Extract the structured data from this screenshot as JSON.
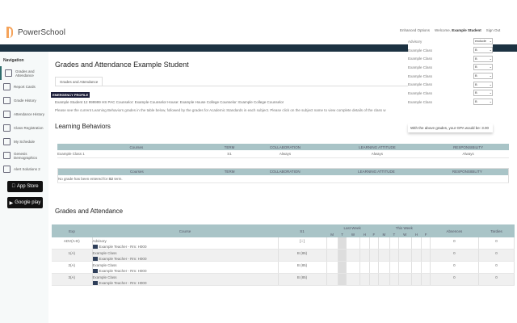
{
  "header": {
    "logo": "PowerSchool",
    "links": [
      "Enhanced Options",
      "Welcome,",
      "Example Student",
      "Sign Out"
    ]
  },
  "nav": {
    "title": "Navigation",
    "items": [
      "Grades and Attendance",
      "Report Cards",
      "Grade History",
      "Attendance History",
      "Class Registration",
      "My Schedule",
      "Genesis Demographics",
      "Alert Solutions 2"
    ],
    "stores": [
      "App Store",
      "Google play"
    ]
  },
  "main": {
    "title": "Grades and Attendance Example Student",
    "tab": "Grades and Attendance",
    "badge": "EMERGENCY PROFILE",
    "info": "Example Student   12   999999          HS      PAC Counselor: Example Counselor    House: Example House    College Counselor: Example College Counselor",
    "note": "Please see the current Learning Behaviors grades in the table below, followed by the grades for Academic Standards in each subject. Please click on the subject name to view complete details of the class w"
  },
  "lb": {
    "title": "Learning Behaviors",
    "headers": [
      "Courses",
      "TERM",
      "COLLABORATION",
      "LEARNING ATTITUDE",
      "RESPONSIBILITY"
    ],
    "row": [
      "Example Class 1",
      "S1",
      "Always",
      "Always",
      "Always"
    ],
    "empty_prefix": "No grade has been entered for ",
    "empty_term": "S2",
    "empty_suffix": " term."
  },
  "popup": {
    "rows": [
      [
        "Advisory",
        "exclude"
      ],
      [
        "Example Class",
        "B"
      ],
      [
        "Example Class",
        "B"
      ],
      [
        "Example Class",
        "B"
      ],
      [
        "Example Class",
        "B"
      ],
      [
        "Example Class",
        "B"
      ],
      [
        "Example Class",
        "B"
      ],
      [
        "Example Class",
        "B"
      ]
    ],
    "gpa": "With the above grades, your GPA would be: 3.00"
  },
  "ga": {
    "title": "Grades and Attendance",
    "headers": {
      "exp": "Exp",
      "course": "Course",
      "s1": "S1",
      "last": "Last Week",
      "this": "This Week",
      "abs": "Absences",
      "tar": "Tardies",
      "days": [
        "M",
        "T",
        "W",
        "H",
        "F",
        "M",
        "T",
        "W",
        "H",
        "F"
      ]
    },
    "rows": [
      {
        "exp": "ADV(A-E)",
        "course": "Advisory",
        "teacher": "Example Teacher - Rm: H000",
        "grade": "[ i ]",
        "abs": "0",
        "tar": "0"
      },
      {
        "exp": "1(A)",
        "course": "Example Class",
        "teacher": "Example Teacher - Rm: H000",
        "grade": "B (85)",
        "abs": "0",
        "tar": "0"
      },
      {
        "exp": "2(A)",
        "course": "Example Class",
        "teacher": "Example Teacher - Rm: H000",
        "grade": "B (85)",
        "abs": "0",
        "tar": "0"
      },
      {
        "exp": "3(A)",
        "course": "Example Class",
        "teacher": "Example Teacher - Rm: H000",
        "grade": "B (85)",
        "abs": "0",
        "tar": "0"
      }
    ]
  }
}
